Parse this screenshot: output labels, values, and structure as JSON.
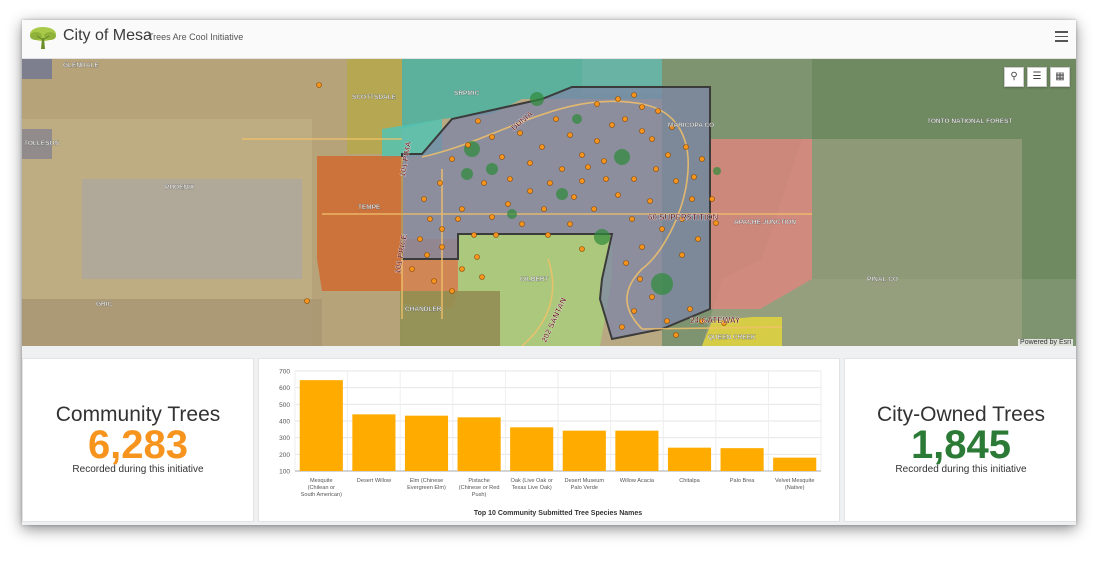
{
  "header": {
    "title": "City of Mesa",
    "subtitle": "Trees Are Cool Initiative",
    "logo": "tree-logo-icon",
    "menu_icon": "hamburger-menu-icon"
  },
  "map": {
    "labels": {
      "glendale": "GLENDALE",
      "scottsdale": "SCOTTSDALE",
      "srpmic": "SRPMIC",
      "tolleson": "TOLLESON",
      "phoenix": "PHOENIX",
      "tempe": "TEMPE",
      "maricopa": "MARICOPA CO",
      "tonto": "TONTO NATIONAL FOREST",
      "apache": "APACHE JUNCTION",
      "gilbert": "GILBERT",
      "chandler": "CHANDLER",
      "gric": "GRIC",
      "pinal": "PINAL CO",
      "queen_creek": "QUEEN CREEK",
      "hwy_pima": "101 PIMA",
      "hwy_price": "101 PRICE",
      "hwy_superstition": "60 SUPERSTITION",
      "hwy_santan": "202 SANTAN",
      "hwy_gateway": "24 GATEWAY",
      "hwy_dunia": "DUNIA"
    },
    "tools": [
      "search-icon",
      "layers-icon",
      "basemap-gallery-icon"
    ],
    "attribution": "Powered by Esri"
  },
  "community": {
    "label": "Community Trees",
    "value": "6,283",
    "caption": "Recorded during this initiative",
    "color": "#f7941d"
  },
  "city": {
    "label": "City-Owned Trees",
    "value": "1,845",
    "caption": "Recorded during this initiative",
    "color": "#2b7a35"
  },
  "chart_data": {
    "type": "bar",
    "title": "Top 10 Community Submitted Tree Species Names",
    "categories": [
      "Mesquite (Chilean or South American)",
      "Desert Willow",
      "Elm (Chinese Evergreen Elm)",
      "Pistache (Chinese or Red Push)",
      "Oak (Live Oak or Texas Live Oak)",
      "Desert Museum Palo Verde",
      "Willow Acacia",
      "Chitalpa",
      "Palo Brea",
      "Velvet Mesquite (Native)"
    ],
    "category_lines": [
      [
        "Mesquite",
        "(Chilean or",
        "South American)"
      ],
      [
        "Desert Willow"
      ],
      [
        "Elm (Chinese",
        "Evergreen Elm)"
      ],
      [
        "Pistache",
        "(Chinese or Red",
        "Push)"
      ],
      [
        "Oak (Live Oak or",
        "Texas Live Oak)"
      ],
      [
        "Desert Museum",
        "Palo Verde"
      ],
      [
        "Willow Acacia"
      ],
      [
        "Chitalpa"
      ],
      [
        "Palo Brea"
      ],
      [
        "Velvet Mesquite",
        "(Native)"
      ]
    ],
    "values": [
      645,
      440,
      432,
      422,
      362,
      342,
      342,
      240,
      237,
      180
    ],
    "ylim": [
      100,
      700
    ],
    "yticks": [
      100,
      200,
      300,
      400,
      500,
      600,
      700
    ],
    "bar_color": "#ffab00",
    "grid": true
  }
}
